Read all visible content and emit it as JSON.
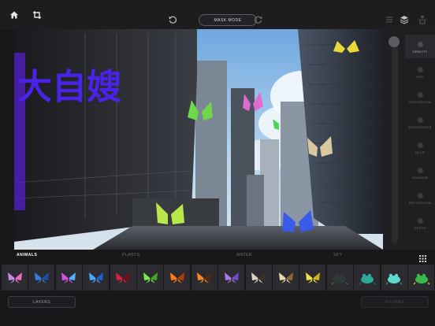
{
  "toolbar": {
    "mode_label": "MASK MODE",
    "icons": [
      "home-icon",
      "crop-icon",
      "undo-icon",
      "redo-icon",
      "list-icon",
      "layers-stack-icon",
      "share-icon"
    ]
  },
  "canvas": {
    "neon_sign_text": "大自嫂"
  },
  "adjustments": {
    "items": [
      {
        "label": "OPACITY",
        "active": true
      },
      {
        "label": "HUE",
        "active": false
      },
      {
        "label": "SATURATION",
        "active": false
      },
      {
        "label": "BRIGHTNESS",
        "active": false
      },
      {
        "label": "BLUR",
        "active": false
      },
      {
        "label": "SHADOW",
        "active": false
      },
      {
        "label": "REFLECTION",
        "active": false
      },
      {
        "label": "DEPTH",
        "active": false
      }
    ]
  },
  "categories": [
    {
      "label": "ANIMALS",
      "active": true
    },
    {
      "label": "PLANTS",
      "active": false
    },
    {
      "label": "WATER",
      "active": false
    },
    {
      "label": "SKY",
      "active": false
    }
  ],
  "thumbnails": [
    {
      "icon": "butterfly-pink-icon",
      "c1": "#c58ae8",
      "c2": "#f06bc0"
    },
    {
      "icon": "butterfly-blue-icon",
      "c1": "#3a7de0",
      "c2": "#1b4fa8"
    },
    {
      "icon": "butterfly-magenta-icon",
      "c1": "#d54fe0",
      "c2": "#4fb0ff"
    },
    {
      "icon": "butterfly-cyan-icon",
      "c1": "#4aa8ff",
      "c2": "#1f5fc8"
    },
    {
      "icon": "butterfly-red-icon",
      "c1": "#d82040",
      "c2": "#7a0c1e"
    },
    {
      "icon": "butterfly-green-icon",
      "c1": "#7ee84a",
      "c2": "#3ca828"
    },
    {
      "icon": "butterfly-orange-icon",
      "c1": "#ff7a1a",
      "c2": "#b33c08"
    },
    {
      "icon": "butterfly-monarch-icon",
      "c1": "#f28a22",
      "c2": "#5a2a0c"
    },
    {
      "icon": "butterfly-violet-icon",
      "c1": "#a87ae8",
      "c2": "#6a4fd0"
    },
    {
      "icon": "butterfly-swallowtail-icon",
      "c1": "#d8d0c0",
      "c2": "#3a3228"
    },
    {
      "icon": "butterfly-tan-icon",
      "c1": "#e8d8b0",
      "c2": "#8a6a3a"
    },
    {
      "icon": "butterfly-yellow-icon",
      "c1": "#f2e24a",
      "c2": "#c9b420"
    },
    {
      "icon": "frog-dark-icon",
      "c1": "#2f3a36",
      "c2": "#5a6a62"
    },
    {
      "icon": "frog-teal-icon",
      "c1": "#2fa89a",
      "c2": "#1b6a62"
    },
    {
      "icon": "frog-aqua-icon",
      "c1": "#5fd8d0",
      "c2": "#2a8a86"
    },
    {
      "icon": "frog-green-icon",
      "c1": "#3ab84a",
      "c2": "#d8c020"
    }
  ],
  "footer": {
    "layers_label": "LAYERS",
    "filters_label": "FILTERS"
  }
}
